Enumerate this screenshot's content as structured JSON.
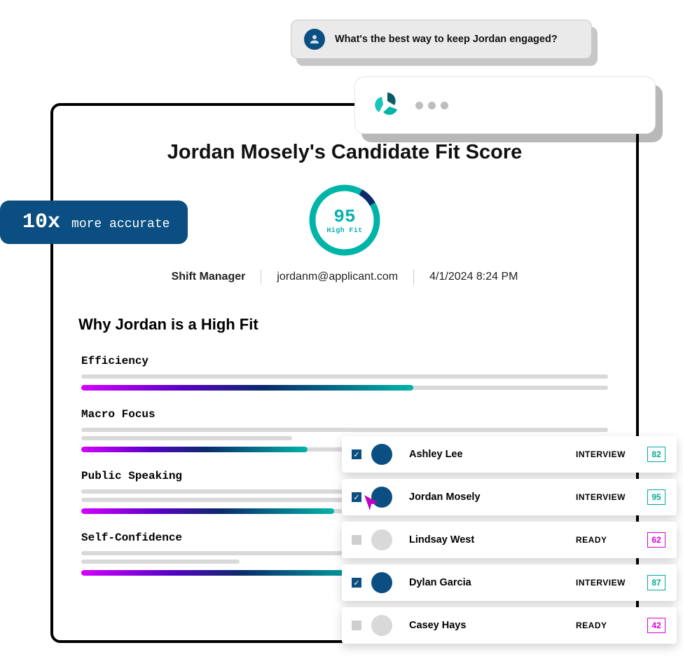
{
  "report": {
    "title": "Jordan Mosely's Candidate Fit Score",
    "score_value": "95",
    "score_label": "High Fit",
    "job_title": "Shift Manager",
    "email": "jordanm@applicant.com",
    "datetime": "4/1/2024  8:24 PM",
    "section_heading": "Why Jordan is a High Fit",
    "traits": [
      {
        "name": "Efficiency",
        "pct": 63
      },
      {
        "name": "Macro Focus",
        "pct": 43
      },
      {
        "name": "Public Speaking",
        "pct": 48
      },
      {
        "name": "Self-Confidence",
        "pct": 55
      }
    ]
  },
  "badge": {
    "highlight": "10x",
    "text": "more accurate"
  },
  "chat": {
    "question": "What's the best way to keep Jordan engaged?"
  },
  "candidates": [
    {
      "name": "Ashley Lee",
      "status": "INTERVIEW",
      "score": "82",
      "selected": true,
      "score_color": "teal"
    },
    {
      "name": "Jordan Mosely",
      "status": "INTERVIEW",
      "score": "95",
      "selected": true,
      "score_color": "teal"
    },
    {
      "name": "Lindsay West",
      "status": "READY",
      "score": "62",
      "selected": false,
      "score_color": "magenta"
    },
    {
      "name": "Dylan Garcia",
      "status": "INTERVIEW",
      "score": "87",
      "selected": true,
      "score_color": "teal"
    },
    {
      "name": "Casey Hays",
      "status": "READY",
      "score": "42",
      "selected": false,
      "score_color": "magenta"
    }
  ]
}
